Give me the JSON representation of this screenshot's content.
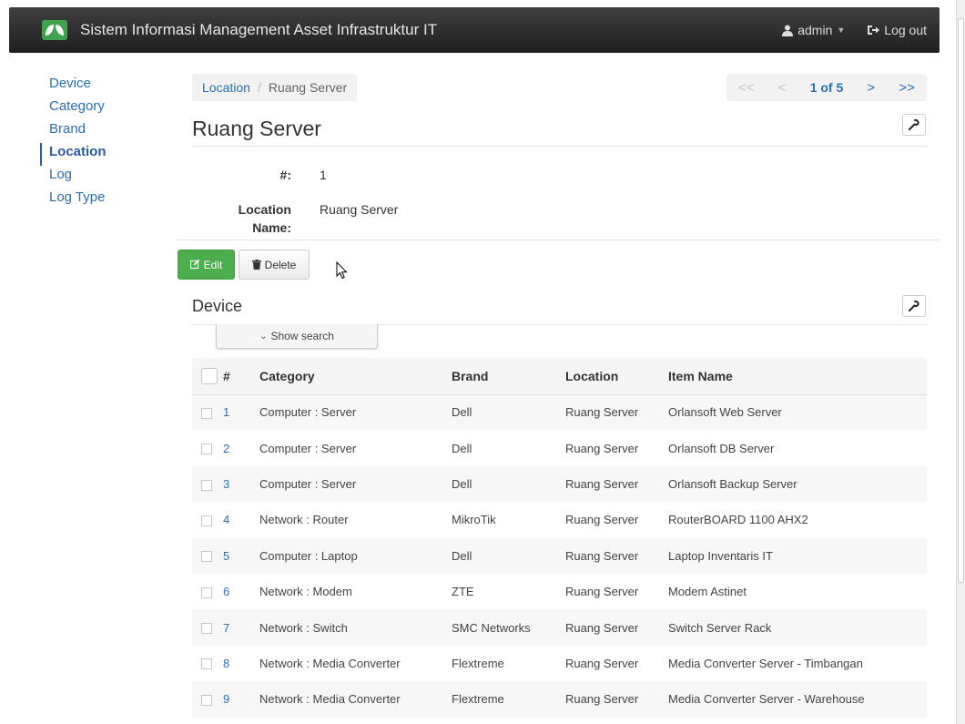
{
  "navbar": {
    "title": "Sistem Informasi Management Asset Infrastruktur IT",
    "user_label": "admin",
    "logout_label": "Log out"
  },
  "sidenav": {
    "items": [
      {
        "label": "Device",
        "active": false
      },
      {
        "label": "Category",
        "active": false
      },
      {
        "label": "Brand",
        "active": false
      },
      {
        "label": "Location",
        "active": true
      },
      {
        "label": "Log",
        "active": false
      },
      {
        "label": "Log Type",
        "active": false
      }
    ]
  },
  "breadcrumb": {
    "parent": "Location",
    "current": "Ruang Server"
  },
  "pager": {
    "first": "<<",
    "prev": "<",
    "position": "1 of 5",
    "next": ">",
    "last": ">>"
  },
  "page_title": "Ruang Server",
  "detail": {
    "id_label": "#:",
    "id_value": "1",
    "name_label_1": "Location",
    "name_label_2": "Name:",
    "name_value": "Ruang Server"
  },
  "actions": {
    "edit_label": "Edit",
    "delete_label": "Delete"
  },
  "device_section": {
    "title": "Device",
    "show_search_label": "Show search",
    "columns": [
      "#",
      "Category",
      "Brand",
      "Location",
      "Item Name"
    ],
    "rows": [
      {
        "num": "1",
        "category": "Computer : Server",
        "brand": "Dell",
        "location": "Ruang Server",
        "item": "Orlansoft Web Server"
      },
      {
        "num": "2",
        "category": "Computer : Server",
        "brand": "Dell",
        "location": "Ruang Server",
        "item": "Orlansoft DB Server"
      },
      {
        "num": "3",
        "category": "Computer : Server",
        "brand": "Dell",
        "location": "Ruang Server",
        "item": "Orlansoft Backup Server"
      },
      {
        "num": "4",
        "category": "Network : Router",
        "brand": "MikroTik",
        "location": "Ruang Server",
        "item": "RouterBOARD 1100 AHX2"
      },
      {
        "num": "5",
        "category": "Computer : Laptop",
        "brand": "Dell",
        "location": "Ruang Server",
        "item": "Laptop Inventaris IT"
      },
      {
        "num": "6",
        "category": "Network : Modem",
        "brand": "ZTE",
        "location": "Ruang Server",
        "item": "Modem Astinet"
      },
      {
        "num": "7",
        "category": "Network : Switch",
        "brand": "SMC Networks",
        "location": "Ruang Server",
        "item": "Switch Server Rack"
      },
      {
        "num": "8",
        "category": "Network : Media Converter",
        "brand": "Flextreme",
        "location": "Ruang Server",
        "item": "Media Converter Server - Timbangan"
      },
      {
        "num": "9",
        "category": "Network : Media Converter",
        "brand": "Flextreme",
        "location": "Ruang Server",
        "item": "Media Converter Server - Warehouse"
      }
    ]
  },
  "colors": {
    "navbar": "#2b2b2b",
    "link": "#2a6fb7",
    "edit_button": "#4cae4c"
  }
}
